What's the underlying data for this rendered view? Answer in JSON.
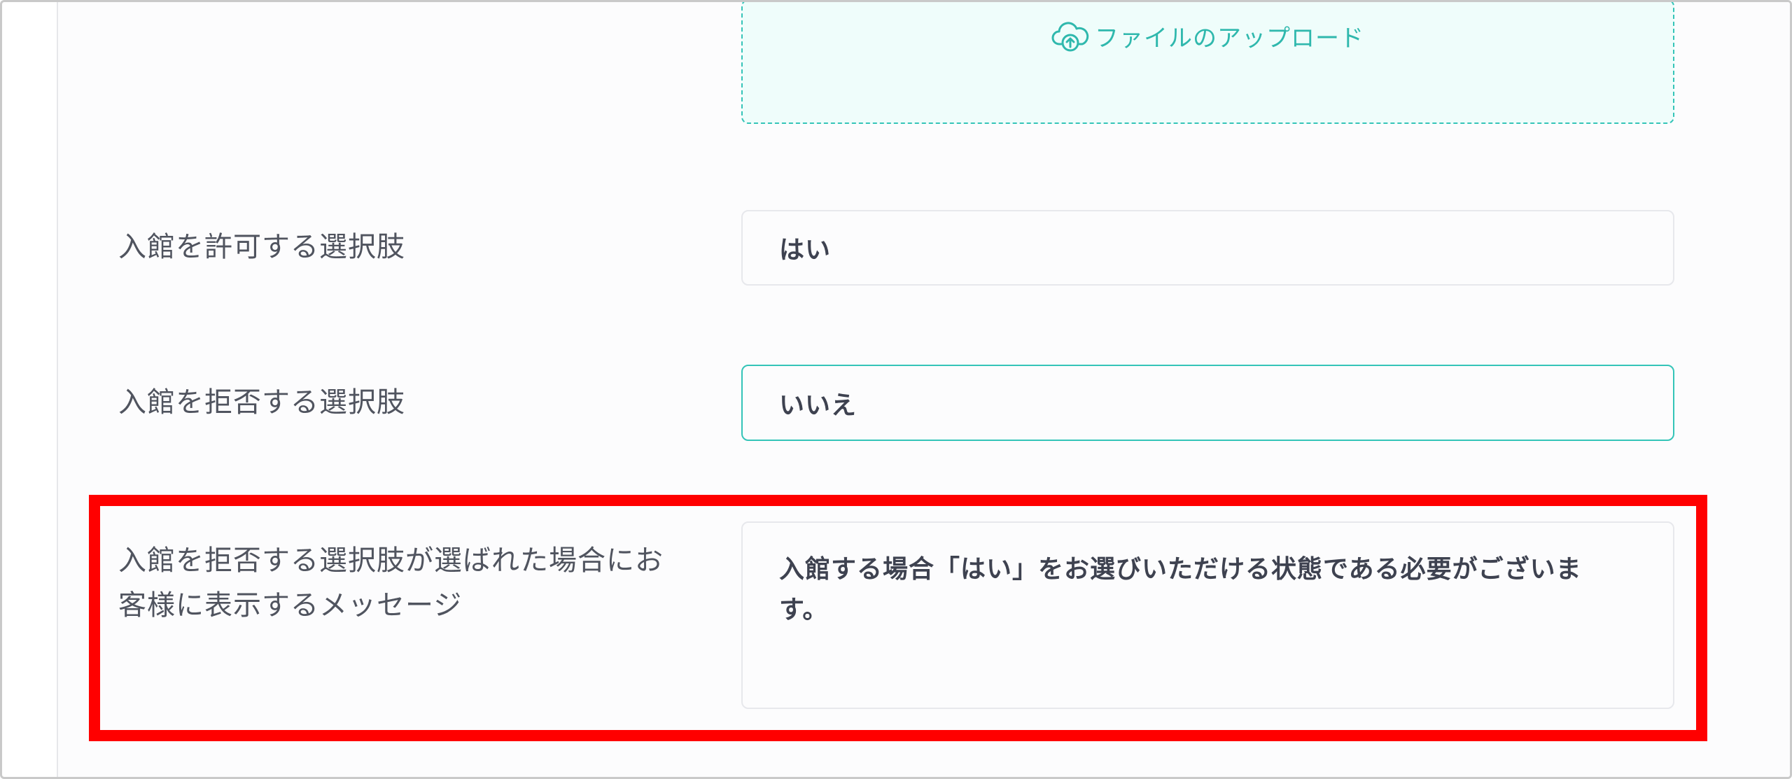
{
  "upload": {
    "label": "ファイルのアップロード",
    "icon": "cloud-upload-icon",
    "accent_color": "#2fb8ad"
  },
  "fields": {
    "allow": {
      "label": "入館を許可する選択肢",
      "value": "はい"
    },
    "deny": {
      "label": "入館を拒否する選択肢",
      "value": "いいえ"
    },
    "deny_message": {
      "label_line1": "入館を拒否する選択肢が選ばれた場合にお",
      "label_line2": "客様に表示するメッセージ",
      "value": "入館する場合「はい」をお選びいただける状態である必要がございます。"
    }
  },
  "annotation": {
    "highlight_color": "#ff0000"
  }
}
